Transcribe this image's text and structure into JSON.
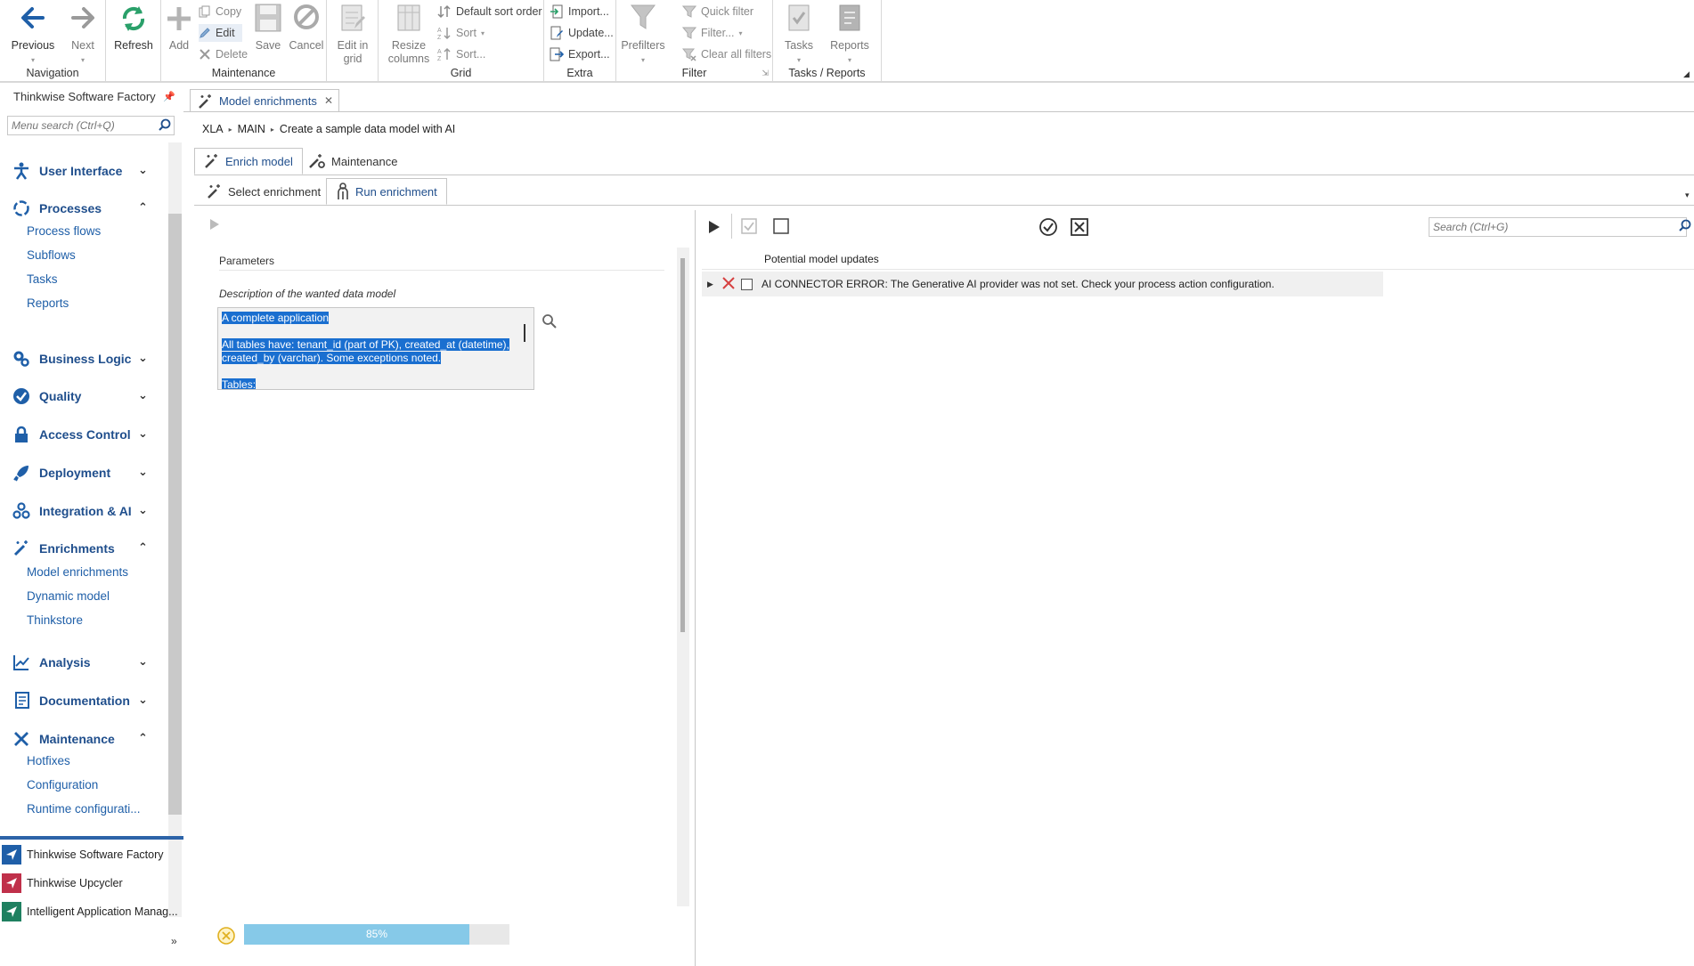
{
  "ribbon": {
    "groups": {
      "navigation": "Navigation",
      "maintenance": "Maintenance",
      "grid": "Grid",
      "extra": "Extra",
      "filter": "Filter",
      "tasks_reports": "Tasks / Reports"
    },
    "previous": "Previous",
    "next": "Next",
    "refresh": "Refresh",
    "add": "Add",
    "copy": "Copy",
    "edit": "Edit",
    "delete": "Delete",
    "save": "Save",
    "cancel": "Cancel",
    "edit_in_grid_1": "Edit in",
    "edit_in_grid_2": "grid",
    "resize_columns_1": "Resize",
    "resize_columns_2": "columns",
    "default_sort_order": "Default sort order",
    "sort": "Sort",
    "sort_dialog": "Sort...",
    "import": "Import...",
    "update": "Update...",
    "export": "Export...",
    "prefilters": "Prefilters",
    "quick_filter": "Quick filter",
    "filter": "Filter...",
    "clear_all_filters": "Clear all filters",
    "tasks": "Tasks",
    "reports": "Reports"
  },
  "sidebar": {
    "title": "Thinkwise Software Factory",
    "search_placeholder": "Menu search (Ctrl+Q)",
    "groups": [
      {
        "label": "User Interface",
        "expanded": false
      },
      {
        "label": "Processes",
        "expanded": true,
        "items": [
          "Process flows",
          "Subflows",
          "Tasks",
          "Reports"
        ]
      },
      {
        "label": "Business Logic",
        "expanded": false
      },
      {
        "label": "Quality",
        "expanded": false
      },
      {
        "label": "Access Control",
        "expanded": false
      },
      {
        "label": "Deployment",
        "expanded": false
      },
      {
        "label": "Integration & AI",
        "expanded": false
      },
      {
        "label": "Enrichments",
        "expanded": true,
        "items": [
          "Model enrichments",
          "Dynamic model",
          "Thinkstore"
        ]
      },
      {
        "label": "Analysis",
        "expanded": false
      },
      {
        "label": "Documentation",
        "expanded": false
      },
      {
        "label": "Maintenance",
        "expanded": true,
        "items": [
          "Hotfixes",
          "Configuration",
          "Runtime  configurati..."
        ]
      }
    ],
    "apps": [
      {
        "label": "Thinkwise Software Factory",
        "color": "#1f5fa8"
      },
      {
        "label": "Thinkwise Upcycler",
        "color": "#c0304a"
      },
      {
        "label": "Intelligent Application Manag...",
        "color": "#1f8060"
      }
    ]
  },
  "document_tab": "Model enrichments",
  "breadcrumb": [
    "XLA",
    "MAIN",
    "Create a sample data model with AI"
  ],
  "tabs": {
    "enrich_model": "Enrich model",
    "maintenance": "Maintenance",
    "select_enrichment": "Select enrichment",
    "run_enrichment": "Run enrichment"
  },
  "parameters": {
    "header": "Parameters",
    "description_label": "Description of the wanted data model",
    "description_lines": [
      "A complete application",
      "All tables have: tenant_id (part of PK), created_at (datetime),",
      "created_by (varchar). Some exceptions noted.",
      "Tables:"
    ]
  },
  "progress": {
    "value": 0.85,
    "label": "85%"
  },
  "results": {
    "search_placeholder": "Search (Ctrl+G)",
    "column_header": "Potential model updates",
    "rows": [
      {
        "message": "AI CONNECTOR ERROR: The Generative AI provider was not set. Check your process action configuration."
      }
    ]
  }
}
